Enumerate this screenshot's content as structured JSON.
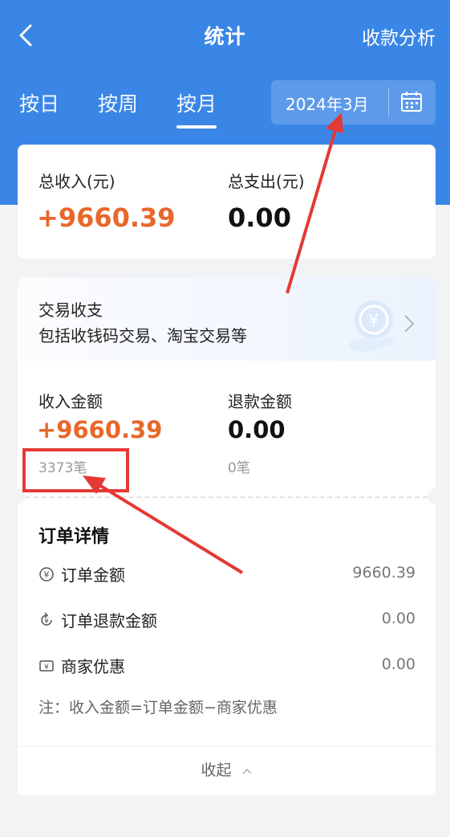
{
  "header": {
    "title": "统计",
    "right_action": "收款分析"
  },
  "tabs": [
    {
      "label": "按日",
      "active": false
    },
    {
      "label": "按周",
      "active": false
    },
    {
      "label": "按月",
      "active": true
    }
  ],
  "date_picker": {
    "value": "2024年3月"
  },
  "summary": {
    "income_label": "总收入(元)",
    "income_value": "+9660.39",
    "expense_label": "总支出(元)",
    "expense_value": "0.00"
  },
  "transactions": {
    "title": "交易收支",
    "subtitle": "包括收钱码交易、淘宝交易等",
    "income_label": "收入金额",
    "income_value": "+9660.39",
    "income_count": "3373笔",
    "refund_label": "退款金额",
    "refund_value": "0.00",
    "refund_count": "0笔"
  },
  "order_details": {
    "title": "订单详情",
    "rows": [
      {
        "label": "订单金额",
        "value": "9660.39",
        "icon": "yen-circle-icon"
      },
      {
        "label": "订单退款金额",
        "value": "0.00",
        "icon": "refund-icon"
      },
      {
        "label": "商家优惠",
        "value": "0.00",
        "icon": "coupon-icon"
      }
    ],
    "note": "注：收入金额=订单金额−商家优惠",
    "collapse_label": "收起"
  },
  "colors": {
    "header_blue": "#3a86e6",
    "income_orange": "#e8672a",
    "annotation_red": "#e53935"
  }
}
